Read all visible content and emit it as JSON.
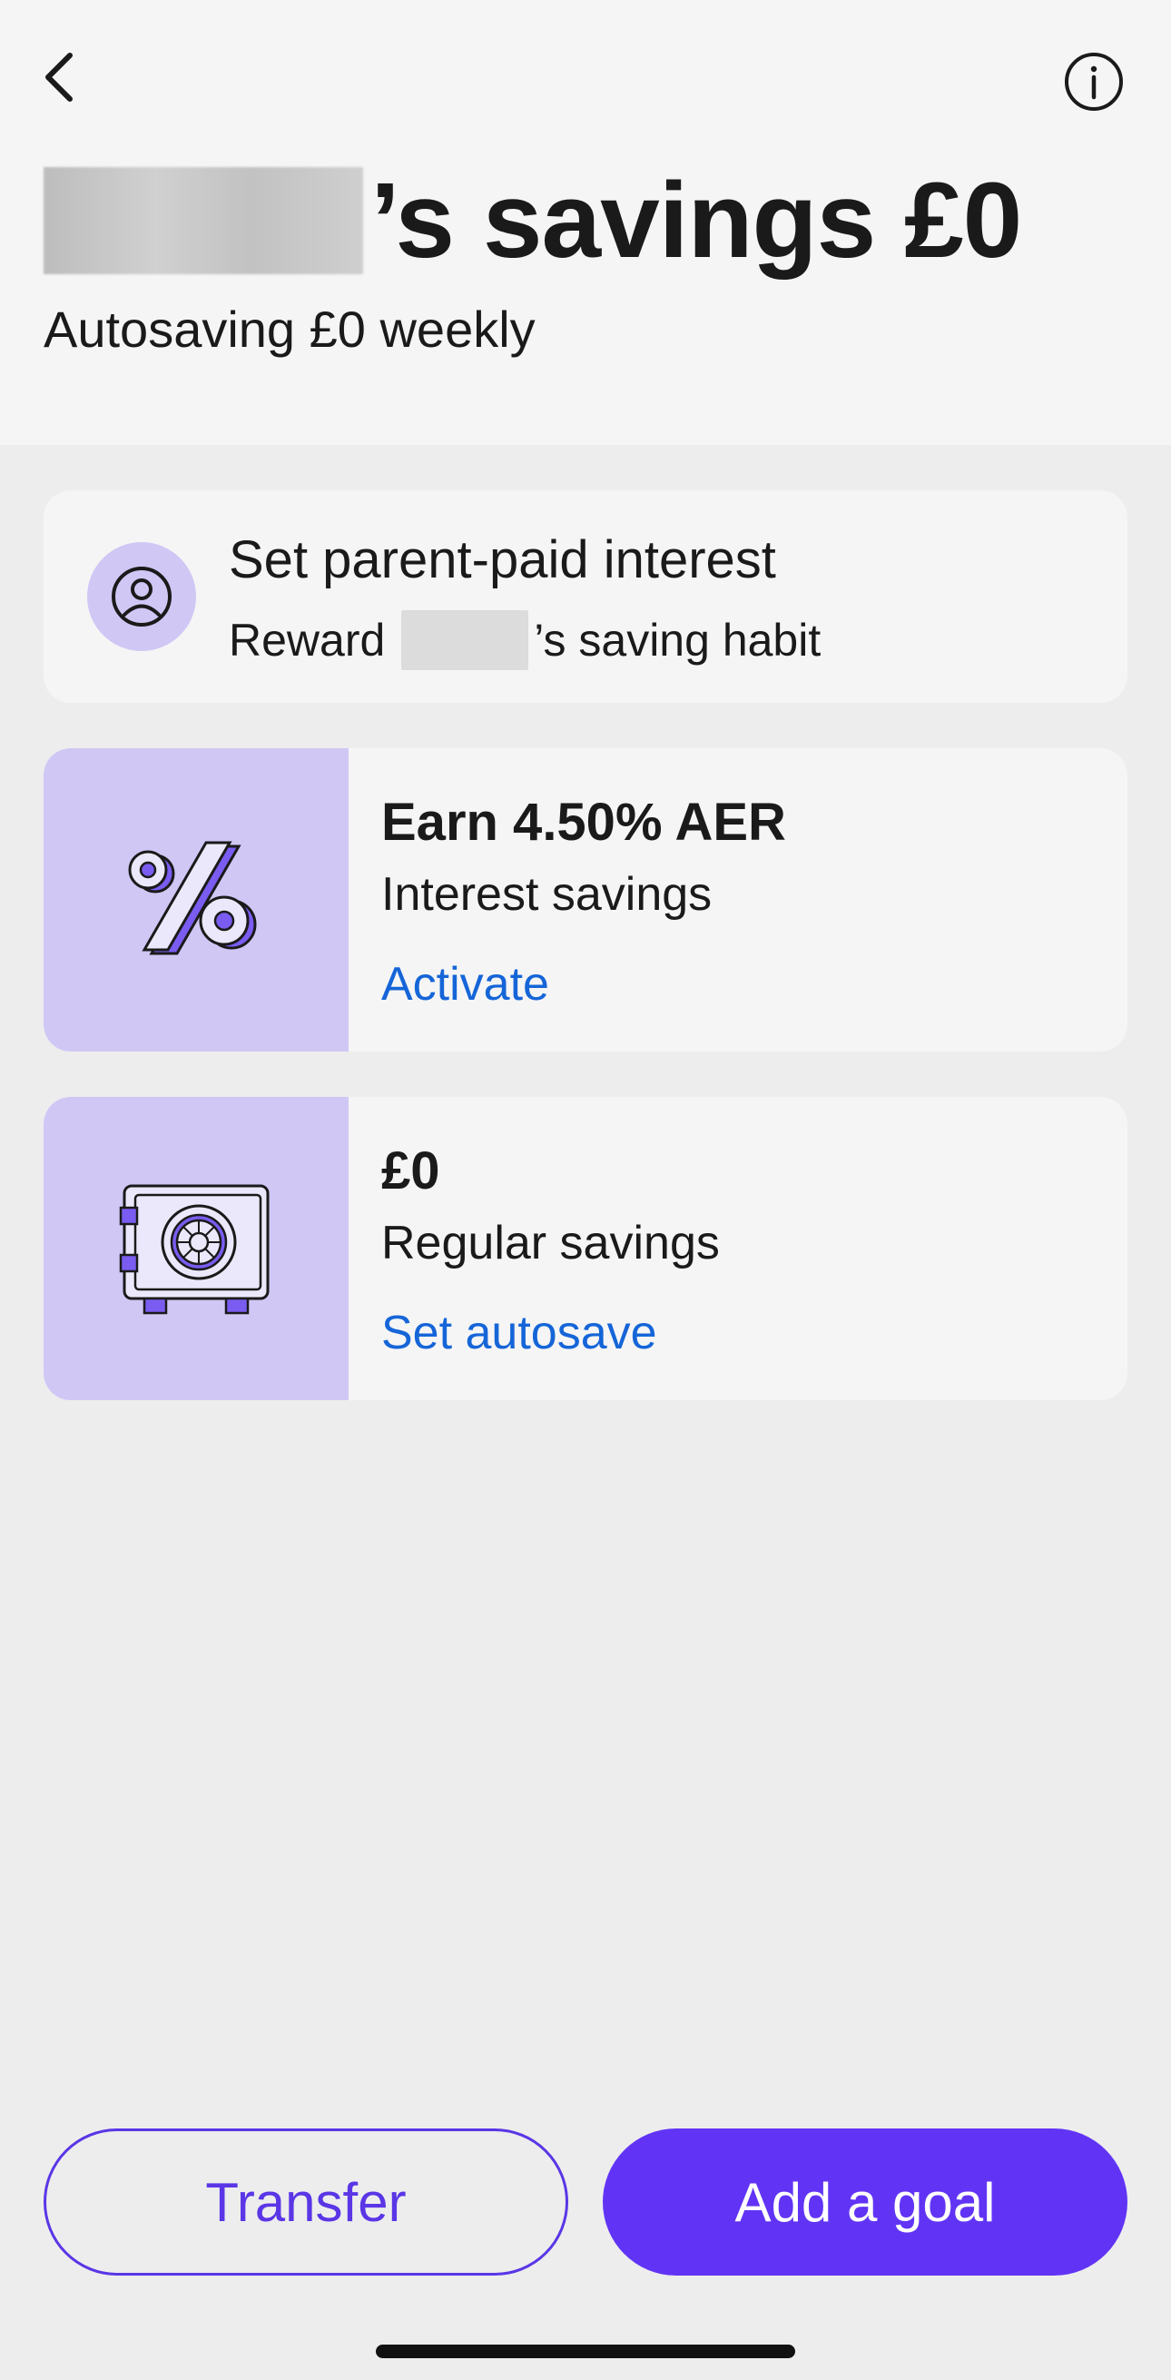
{
  "header": {
    "title": "’s savings £0",
    "subtitle": "Autosaving £0 weekly",
    "icons": {
      "back": "chevron-left-icon",
      "info": "info-circle-icon"
    }
  },
  "interest_card": {
    "title": "Set parent-paid interest",
    "subtitle_prefix": "Reward",
    "subtitle_suffix": "’s saving habit",
    "icon": "user-circle-icon"
  },
  "aer_card": {
    "title": "Earn 4.50% AER",
    "subtitle": "Interest savings",
    "link": "Activate",
    "icon": "percent-icon"
  },
  "savings_card": {
    "title": "£0",
    "subtitle": "Regular savings",
    "link": "Set autosave",
    "icon": "safe-icon"
  },
  "actions": {
    "transfer": "Transfer",
    "add_goal": "Add a goal"
  },
  "colors": {
    "accent": "#6134f5",
    "link": "#1565d8",
    "panel": "#d0c7f5",
    "background": "#ededed",
    "card": "#f5f5f5"
  }
}
